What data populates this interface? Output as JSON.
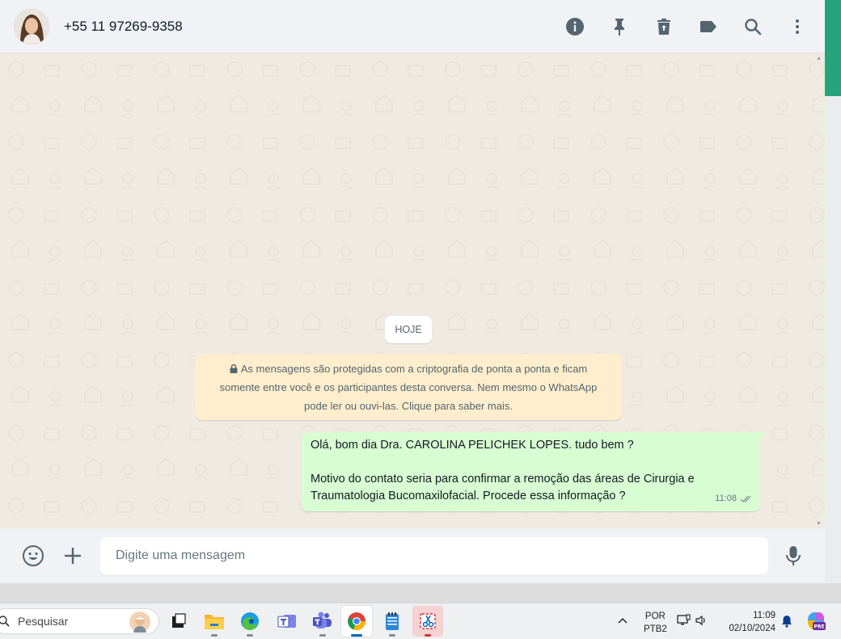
{
  "header": {
    "contact_name": "+55 11 97269-9358",
    "icons": [
      "info-icon",
      "pin-icon",
      "delete-icon",
      "label-icon",
      "search-icon",
      "menu-icon"
    ]
  },
  "chat": {
    "date_chip": "HOJE",
    "e2e_notice": {
      "line1": "As mensagens são protegidas com a criptografia de ponta a ponta e ficam",
      "line2": "somente entre você e os participantes desta conversa. Nem mesmo o WhatsApp",
      "line3": "pode ler ou ouvi-las. Clique para saber mais."
    },
    "messages": [
      {
        "direction": "outgoing",
        "line1": "Olá, bom dia Dra. CAROLINA PELICHEK LOPES. tudo bem ?",
        "line2": "Motivo do contato seria para confirmar a remoção das áreas de  Cirurgia e",
        "line3": "Traumatologia Bucomaxilofacial. Procede essa informação ?",
        "time": "11:08",
        "status": "read"
      }
    ]
  },
  "composer": {
    "placeholder": "Digite uma mensagem"
  },
  "taskbar": {
    "search_label": "Pesquisar",
    "lang_line1": "POR",
    "lang_line2": "PTB2",
    "time": "11:09",
    "date": "02/10/2024",
    "copilot_badge": "PRE"
  },
  "colors": {
    "header_bg": "#f0f2f5",
    "chat_bg": "#efeae2",
    "outgoing_bubble": "#d9fdd3",
    "notice_bg": "#ffeecd",
    "accent": "#25a37a"
  }
}
